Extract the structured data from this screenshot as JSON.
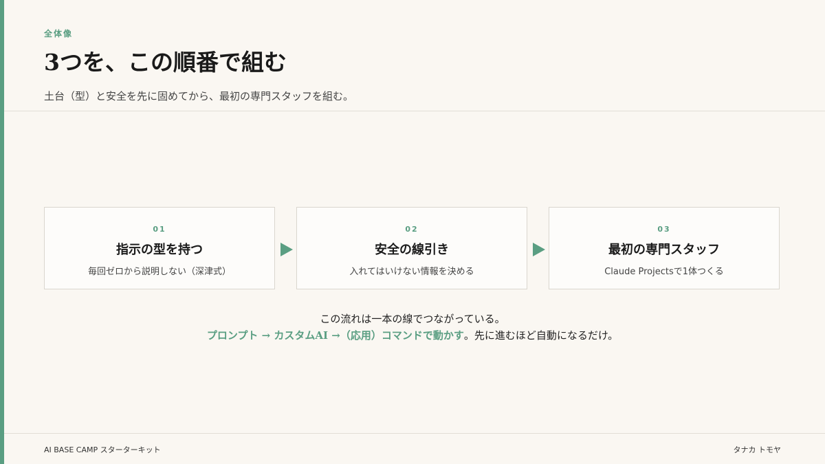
{
  "header": {
    "eyebrow": "全体像",
    "title": "3つを、この順番で組む",
    "subtitle": "土台（型）と安全を先に固めてから、最初の専門スタッフを組む。"
  },
  "steps": [
    {
      "number": "01",
      "title": "指示の型を持つ",
      "description": "毎回ゼロから説明しない（深津式）"
    },
    {
      "number": "02",
      "title": "安全の線引き",
      "description": "入れてはいけない情報を決める"
    },
    {
      "number": "03",
      "title": "最初の専門スタッフ",
      "description": "Claude Projectsで1体つくる"
    }
  ],
  "flow": {
    "line1": "この流れは一本の線でつながっている。",
    "highlight": "プロンプト → カスタムAI →（応用）コマンドで動かす",
    "line2_rest": "。先に進むほど自動になるだけ。"
  },
  "footer": {
    "left": "AI BASE CAMP スターターキット",
    "right": "タナカ トモヤ"
  },
  "colors": {
    "accent": "#5a9e82",
    "background": "#faf7f2",
    "card_border": "#dad6ce"
  },
  "icons": {
    "step_arrow": "play-triangle-right"
  }
}
